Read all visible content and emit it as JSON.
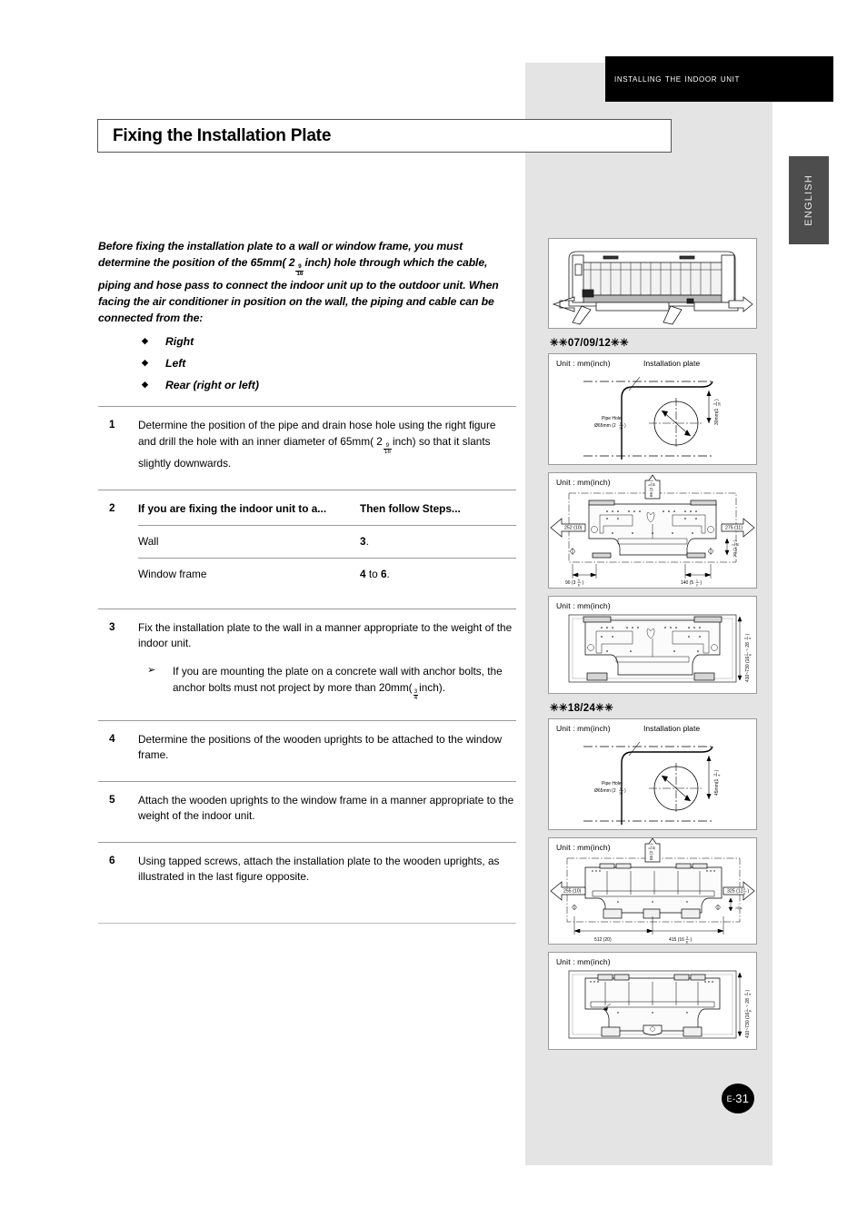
{
  "header": {
    "banner_title": "Installing the Indoor Unit",
    "language_tab": "ENGLISH",
    "page_number_prefix": "E-",
    "page_number": "31"
  },
  "title": "Fixing the Installation Plate",
  "intro": {
    "part1": "Before fixing the installation plate to a wall or window frame, you must determine the position of the 65mm( 2",
    "frac_n": "9",
    "frac_d": "16",
    "part2": "inch) hole through which the cable, piping and hose pass to connect the indoor unit up to the outdoor unit. When facing the air conditioner in position on the wall, the piping and cable can be connected from the:"
  },
  "bullets": [
    {
      "marker": "◆",
      "label": "Right"
    },
    {
      "marker": "◆",
      "label": "Left"
    },
    {
      "marker": "◆",
      "label": "Rear (right or left)"
    }
  ],
  "steps": [
    {
      "num": "1",
      "text_a": "Determine the position of the pipe and drain hose hole using the right figure and drill the hole with an inner diameter of 65mm(",
      "frac_whole": "2",
      "frac_n": "9",
      "frac_d": "16",
      "text_b": "inch) so that it slants slightly downwards."
    },
    {
      "num": "2",
      "table": {
        "headers": [
          "If you are fixing the indoor unit to a...",
          "Then follow Steps..."
        ],
        "rows": [
          {
            "condition": "Wall",
            "steps_bold": "3",
            "steps_tail": "."
          },
          {
            "condition": "Window frame",
            "steps_bold": "4",
            "steps_mid": " to ",
            "steps_bold2": "6",
            "steps_tail": "."
          }
        ]
      }
    },
    {
      "num": "3",
      "text_a": "Fix the installation plate to the wall in a manner appropriate to the weight of the indoor unit.",
      "substep": {
        "marker": "➢",
        "text_a": "If you are mounting the plate on a concrete wall with anchor bolts, the anchor bolts must not project by more than 20mm(",
        "frac_n": "3",
        "frac_d": "4",
        "text_b": "inch)."
      }
    },
    {
      "num": "4",
      "text_a": "Determine the positions of the wooden uprights to be attached to the window frame."
    },
    {
      "num": "5",
      "text_a": "Attach the wooden uprights to the window frame in a manner appropriate to the weight of the indoor unit."
    },
    {
      "num": "6",
      "text_a": "Using tapped screws, attach the installation plate to the wooden uprights, as illustrated in the last figure opposite."
    }
  ],
  "figures": {
    "unit_caption": "Unit : mm(inch)",
    "installation_plate_label": "Installation plate",
    "pipe_hole_label": "Pipe Hole",
    "model_label_small": "✳✳07/09/12✳✳",
    "model_label_large": "✳✳18/24✳✳",
    "fig1": {
      "name": "indoor-unit-front-view"
    },
    "fig2": {
      "pipe_hole_dim": "Ø65mm (2",
      "pipe_hole_frac_n": "9",
      "pipe_hole_frac_d": "16",
      "pipe_hole_tail": ")",
      "vertical_dim": "30mm(1",
      "vertical_frac_n": "3",
      "vertical_frac_d": "16",
      "vertical_tail": ")"
    },
    "fig3": {
      "left_dim": "252 (10)",
      "right_dim": "275 (11)",
      "top_dim": "65 (2",
      "top_frac_n": "9",
      "top_frac_d": "16",
      "top_tail": ")",
      "bottom_left_dim": "90 (3",
      "bottom_left_frac_n": "5",
      "bottom_left_frac_d": "8",
      "bottom_left_tail": ")",
      "bottom_right_dim": "140 (5",
      "bottom_right_frac_n": "1",
      "bottom_right_frac_d": "2",
      "bottom_right_tail": ")",
      "right_small_dim": "30 (1",
      "right_small_frac_n": "3",
      "right_small_frac_d": "16",
      "right_small_tail": ")"
    },
    "fig4": {
      "vertical_dim": "410~730 (16",
      "v_frac1_n": "1",
      "v_frac1_d": "8",
      "v_mid": "~ 28",
      "v_frac2_n": "3",
      "v_frac2_d": "4",
      "v_tail": ")"
    },
    "fig5": {
      "pipe_hole_dim": "Ø65mm (2",
      "pipe_hole_frac_n": "9",
      "pipe_hole_frac_d": "16",
      "pipe_hole_tail": ")",
      "vertical_dim": "45mm(1",
      "vertical_frac_n": "3",
      "vertical_frac_d": "4",
      "vertical_tail": ")"
    },
    "fig6": {
      "left_dim": "255 (10)",
      "right_dim": "325 (12",
      "right_frac_n": "3",
      "right_frac_d": "4",
      "right_tail": ")",
      "top_dim": "65 (2",
      "top_frac_n": "9",
      "top_frac_d": "16",
      "top_tail": ")",
      "bottom_left_dim": "512 (20)",
      "bottom_right_dim": "415 (16",
      "bottom_right_frac_n": "3",
      "bottom_right_frac_d": "8",
      "bottom_right_tail": ")",
      "right_small_frac_n": "3",
      "right_small_frac_d": "8"
    },
    "fig7": {
      "vertical_dim": "410~730 (16",
      "v_frac1_n": "1",
      "v_frac1_d": "8",
      "v_mid": "~ 28",
      "v_frac2_n": "3",
      "v_frac2_d": "4",
      "v_tail": ")"
    }
  }
}
